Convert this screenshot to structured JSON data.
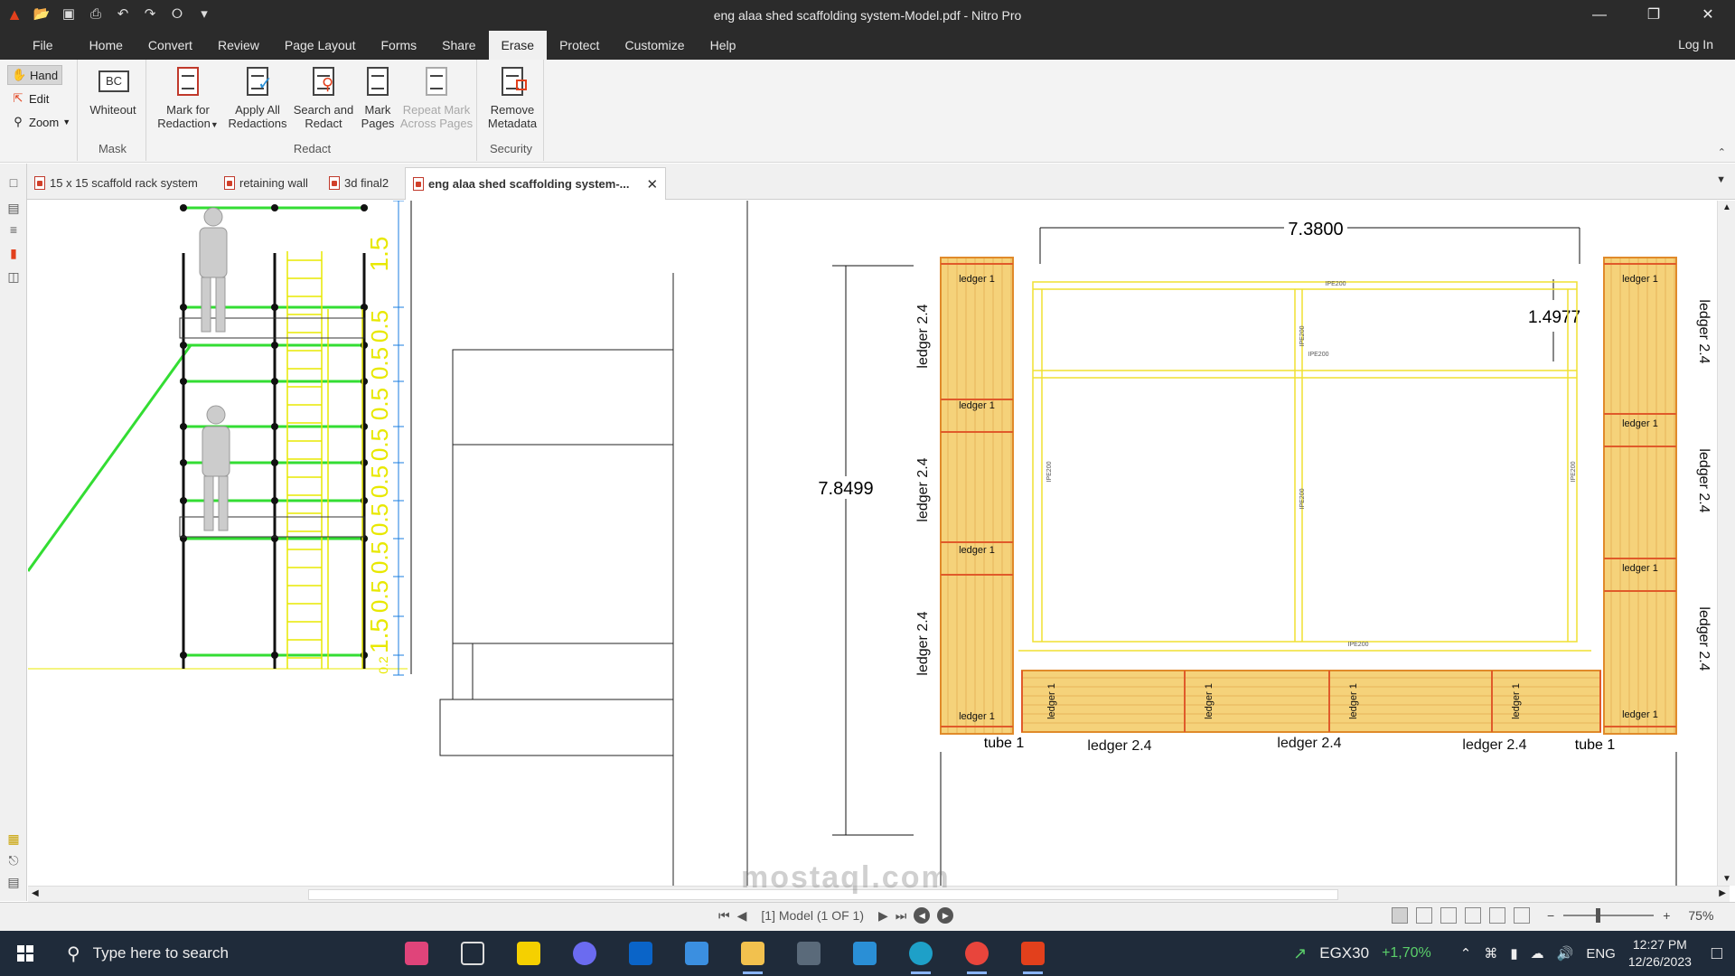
{
  "window": {
    "title": "eng alaa shed scaffolding system-Model.pdf - Nitro Pro"
  },
  "menu": {
    "file": "File",
    "tabs": [
      "Home",
      "Convert",
      "Review",
      "Page Layout",
      "Forms",
      "Share",
      "Erase",
      "Protect",
      "Customize",
      "Help"
    ],
    "active": "Erase",
    "login": "Log In"
  },
  "ribbon": {
    "hand": "Hand",
    "edit": "Edit",
    "zoom": "Zoom",
    "whiteout": "Whiteout",
    "mask_group": "Mask",
    "mark_for_redaction_1": "Mark for",
    "mark_for_redaction_2": "Redaction",
    "apply_all_1": "Apply All",
    "apply_all_2": "Redactions",
    "search_redact_1": "Search and",
    "search_redact_2": "Redact",
    "mark_pages_1": "Mark",
    "mark_pages_2": "Pages",
    "repeat_mark_1": "Repeat Mark",
    "repeat_mark_2": "Across Pages",
    "redact_group": "Redact",
    "remove_meta_1": "Remove",
    "remove_meta_2": "Metadata",
    "security_group": "Security"
  },
  "doc_tabs": [
    "15 x 15 scaffold rack system",
    "retaining wall",
    "3d final2",
    "eng alaa shed scaffolding system-..."
  ],
  "drawing": {
    "left_dims": [
      "1.5",
      "0.5",
      "0.5",
      "0.5",
      "0.5",
      "0.5",
      "0.5",
      "0.5",
      "0.5",
      "1.5",
      "0.2"
    ],
    "dim_width": "7.3800",
    "dim_height": "7.8499",
    "dim_small": "1.4977",
    "ledger_1": "ledger 1",
    "ledger_24": "ledger 2.4",
    "tube_1": "tube 1",
    "ipe": "IPE200"
  },
  "status": {
    "page": "[1] Model (1 OF 1)",
    "zoom": "75%"
  },
  "taskbar": {
    "search_placeholder": "Type here to search",
    "ticker": "EGX30",
    "ticker_change": "+1,70%",
    "lang": "ENG",
    "time": "12:27 PM",
    "date": "12/26/2023"
  },
  "watermark": "mostaql.com",
  "colors": {
    "accent": "#e2401c",
    "titlebar": "#2b2b2b",
    "timber": "#f5d27a",
    "frame": "#f0e030"
  }
}
